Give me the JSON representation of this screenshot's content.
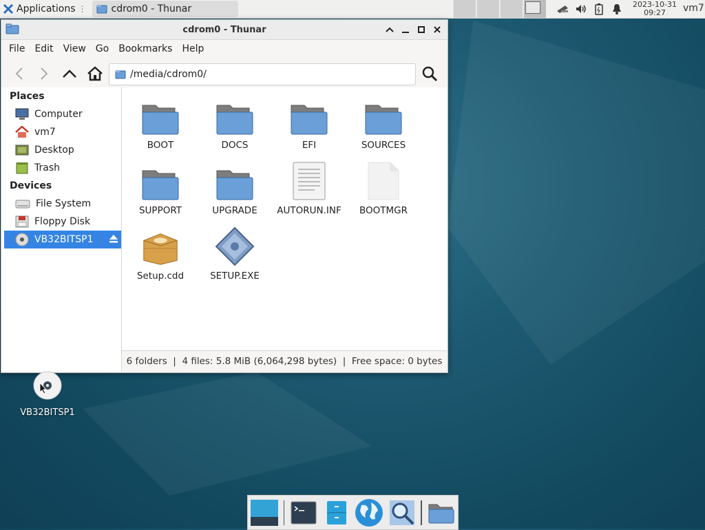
{
  "panel": {
    "applications_label": "Applications",
    "task_title": "cdrom0 - Thunar",
    "clock_date": "2023-10-31",
    "clock_time": "09:27",
    "user": "vm7",
    "tray_icons": [
      "network-icon",
      "volume-icon",
      "battery-icon",
      "notification-icon"
    ]
  },
  "window": {
    "title": "cdrom0 - Thunar",
    "menu": [
      "File",
      "Edit",
      "View",
      "Go",
      "Bookmarks",
      "Help"
    ],
    "location": "/media/cdrom0/",
    "sidebar": {
      "places_header": "Places",
      "places": [
        "Computer",
        "vm7",
        "Desktop",
        "Trash"
      ],
      "devices_header": "Devices",
      "devices": [
        "File System",
        "Floppy Disk",
        "VB32BITSP1"
      ],
      "selected": "VB32BITSP1"
    },
    "files": [
      {
        "name": "BOOT",
        "type": "folder"
      },
      {
        "name": "DOCS",
        "type": "folder"
      },
      {
        "name": "EFI",
        "type": "folder"
      },
      {
        "name": "SOURCES",
        "type": "folder"
      },
      {
        "name": "SUPPORT",
        "type": "folder"
      },
      {
        "name": "UPGRADE",
        "type": "folder"
      },
      {
        "name": "AUTORUN.INF",
        "type": "text"
      },
      {
        "name": "BOOTMGR",
        "type": "blank"
      },
      {
        "name": "Setup.cdd",
        "type": "package"
      },
      {
        "name": "SETUP.EXE",
        "type": "executable"
      }
    ],
    "status": "6 folders  |  4 files: 5.8 MiB (6,064,298 bytes)  |  Free space: 0 bytes"
  },
  "desktop": {
    "icon_label": "VB32BITSP1"
  },
  "dock": [
    "show-desktop-icon",
    "terminal-icon",
    "file-manager-icon",
    "web-browser-icon",
    "app-finder-icon",
    "home-folder-icon"
  ],
  "colors": {
    "selection": "#3584e4",
    "folder_blue": "#6a9fd8",
    "desktop": "#1d5a72"
  }
}
